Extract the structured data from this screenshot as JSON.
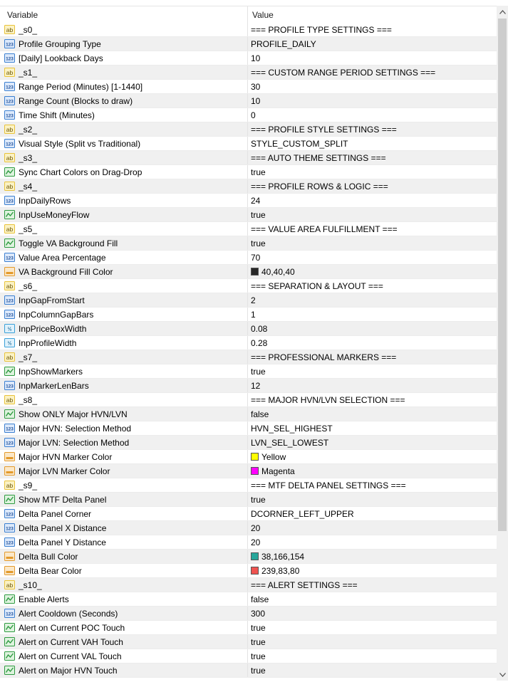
{
  "header": {
    "variable": "Variable",
    "value": "Value"
  },
  "colors": {
    "icon_ab": "#e8c23a",
    "icon_123": "#3a7fd0",
    "icon_bool": "#2e9a40",
    "icon_color": "#e39a2c",
    "icon_double": "#3aa0d8"
  },
  "rows": [
    {
      "type": "ab",
      "name": "_s0_",
      "value": "=== PROFILE TYPE SETTINGS ==="
    },
    {
      "type": "123",
      "name": "Profile Grouping Type",
      "value": "PROFILE_DAILY"
    },
    {
      "type": "123",
      "name": "[Daily] Lookback Days",
      "value": "10"
    },
    {
      "type": "ab",
      "name": "_s1_",
      "value": "=== CUSTOM RANGE PERIOD SETTINGS ==="
    },
    {
      "type": "123",
      "name": "Range Period (Minutes) [1-1440]",
      "value": "30"
    },
    {
      "type": "123",
      "name": "Range Count (Blocks to draw)",
      "value": "10"
    },
    {
      "type": "123",
      "name": "Time Shift (Minutes)",
      "value": "0"
    },
    {
      "type": "ab",
      "name": "_s2_",
      "value": "=== PROFILE STYLE SETTINGS ==="
    },
    {
      "type": "123",
      "name": "Visual Style (Split vs Traditional)",
      "value": "STYLE_CUSTOM_SPLIT"
    },
    {
      "type": "ab",
      "name": "_s3_",
      "value": "=== AUTO THEME SETTINGS ==="
    },
    {
      "type": "bool",
      "name": "Sync Chart Colors on Drag-Drop",
      "value": "true"
    },
    {
      "type": "ab",
      "name": "_s4_",
      "value": "=== PROFILE ROWS & LOGIC ==="
    },
    {
      "type": "123",
      "name": "InpDailyRows",
      "value": "24"
    },
    {
      "type": "bool",
      "name": "InpUseMoneyFlow",
      "value": "true"
    },
    {
      "type": "ab",
      "name": "_s5_",
      "value": "=== VALUE AREA FULFILLMENT ==="
    },
    {
      "type": "bool",
      "name": "Toggle VA Background Fill",
      "value": "true"
    },
    {
      "type": "123",
      "name": "Value Area Percentage",
      "value": "70"
    },
    {
      "type": "color",
      "name": "VA Background Fill Color",
      "value": "40,40,40",
      "swatch": "#282828"
    },
    {
      "type": "ab",
      "name": "_s6_",
      "value": "=== SEPARATION & LAYOUT ==="
    },
    {
      "type": "123",
      "name": "InpGapFromStart",
      "value": "2"
    },
    {
      "type": "123",
      "name": "InpColumnGapBars",
      "value": "1"
    },
    {
      "type": "double",
      "name": "InpPriceBoxWidth",
      "value": "0.08"
    },
    {
      "type": "double",
      "name": "InpProfileWidth",
      "value": "0.28"
    },
    {
      "type": "ab",
      "name": "_s7_",
      "value": "=== PROFESSIONAL MARKERS ==="
    },
    {
      "type": "bool",
      "name": "InpShowMarkers",
      "value": "true"
    },
    {
      "type": "123",
      "name": "InpMarkerLenBars",
      "value": "12"
    },
    {
      "type": "ab",
      "name": "_s8_",
      "value": "=== MAJOR HVN/LVN SELECTION ==="
    },
    {
      "type": "bool",
      "name": "Show ONLY Major HVN/LVN",
      "value": "false"
    },
    {
      "type": "123",
      "name": "Major HVN: Selection Method",
      "value": "HVN_SEL_HIGHEST"
    },
    {
      "type": "123",
      "name": "Major LVN: Selection Method",
      "value": "LVN_SEL_LOWEST"
    },
    {
      "type": "color",
      "name": "Major HVN Marker Color",
      "value": "Yellow",
      "swatch": "#ffff00"
    },
    {
      "type": "color",
      "name": "Major LVN Marker Color",
      "value": "Magenta",
      "swatch": "#ff00ff"
    },
    {
      "type": "ab",
      "name": "_s9_",
      "value": "=== MTF DELTA PANEL SETTINGS ==="
    },
    {
      "type": "bool",
      "name": "Show MTF Delta Panel",
      "value": "true"
    },
    {
      "type": "123",
      "name": "Delta Panel Corner",
      "value": "DCORNER_LEFT_UPPER"
    },
    {
      "type": "123",
      "name": "Delta Panel X Distance",
      "value": "20"
    },
    {
      "type": "123",
      "name": "Delta Panel Y Distance",
      "value": "20"
    },
    {
      "type": "color",
      "name": "Delta Bull Color",
      "value": "38,166,154",
      "swatch": "#26a69a"
    },
    {
      "type": "color",
      "name": "Delta Bear Color",
      "value": "239,83,80",
      "swatch": "#ef5350"
    },
    {
      "type": "ab",
      "name": "_s10_",
      "value": "=== ALERT SETTINGS ==="
    },
    {
      "type": "bool",
      "name": "Enable Alerts",
      "value": "false"
    },
    {
      "type": "123",
      "name": "Alert Cooldown (Seconds)",
      "value": "300"
    },
    {
      "type": "bool",
      "name": "Alert on Current POC Touch",
      "value": "true"
    },
    {
      "type": "bool",
      "name": "Alert on Current VAH Touch",
      "value": "true"
    },
    {
      "type": "bool",
      "name": "Alert on Current VAL Touch",
      "value": "true"
    },
    {
      "type": "bool",
      "name": "Alert on Major HVN Touch",
      "value": "true"
    }
  ]
}
